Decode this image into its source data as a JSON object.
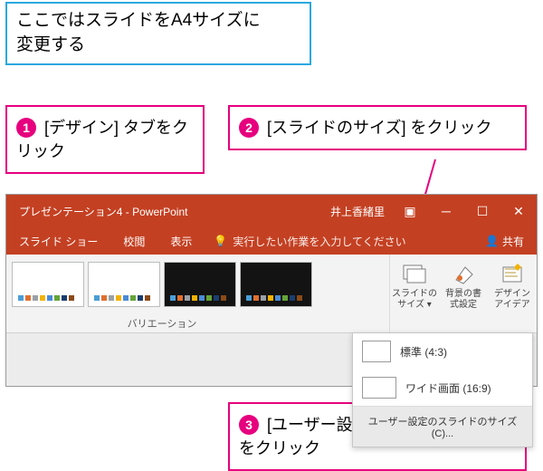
{
  "info": {
    "line1": "ここではスライドをA4サイズに",
    "line2": "変更する"
  },
  "callouts": {
    "c1": {
      "num": "1",
      "text": " [デザイン] タブをクリック"
    },
    "c2": {
      "num": "2",
      "text": " [スライドのサイズ] をクリック"
    },
    "c3": {
      "num": "3",
      "text": " [ユーザー設定のスライドサイズ]をクリック"
    }
  },
  "app": {
    "title": "プレゼンテーション4 - PowerPoint",
    "user": "井上香緒里",
    "tabs": {
      "slideshow": "スライド ショー",
      "review": "校閲",
      "view": "表示"
    },
    "search_placeholder": "実行したい作業を入力してください",
    "share": "共有",
    "variations_label": "バリエーション",
    "buttons": {
      "slide_size": {
        "l1": "スライドの",
        "l2": "サイズ ▾"
      },
      "background": {
        "l1": "背景の書",
        "l2": "式設定"
      },
      "design_ideas": {
        "l1": "デザイン",
        "l2": "アイデア"
      }
    },
    "dropdown": {
      "standard": "標準 (4:3)",
      "wide": "ワイド画面 (16:9)",
      "custom": "ユーザー設定のスライドのサイズ(C)..."
    }
  }
}
